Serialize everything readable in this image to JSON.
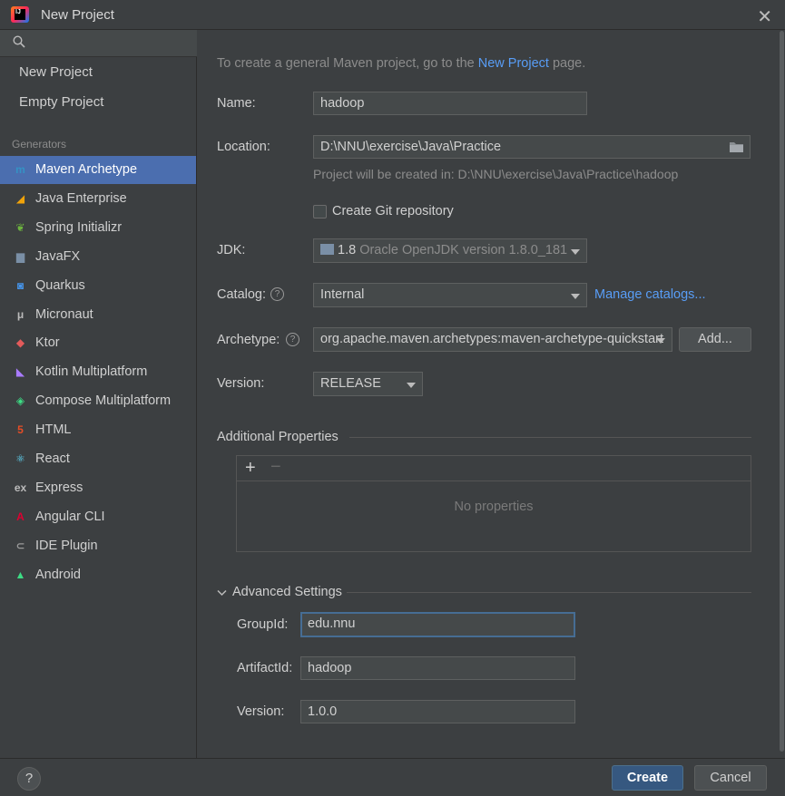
{
  "window": {
    "title": "New Project",
    "app_logo_text": "IJ"
  },
  "sidebar": {
    "search_placeholder": "",
    "links": [
      "New Project",
      "Empty Project"
    ],
    "generators_header": "Generators",
    "generators": [
      {
        "label": "Maven Archetype",
        "icon": "maven-icon",
        "glyph": "m",
        "color": "#3592c4"
      },
      {
        "label": "Java Enterprise",
        "icon": "java-enterprise-icon",
        "glyph": "◢",
        "color": "#f0a30a"
      },
      {
        "label": "Spring Initializr",
        "icon": "spring-icon",
        "glyph": "❦",
        "color": "#6db33f"
      },
      {
        "label": "JavaFX",
        "icon": "javafx-folder-icon",
        "glyph": "▆",
        "color": "#7a8fa6"
      },
      {
        "label": "Quarkus",
        "icon": "quarkus-icon",
        "glyph": "◙",
        "color": "#4695eb"
      },
      {
        "label": "Micronaut",
        "icon": "micronaut-icon",
        "glyph": "μ",
        "color": "#bbbbbb"
      },
      {
        "label": "Ktor",
        "icon": "ktor-icon",
        "glyph": "◆",
        "color": "#e35b5b"
      },
      {
        "label": "Kotlin Multiplatform",
        "icon": "kotlin-icon",
        "glyph": "◣",
        "color": "#a97bff"
      },
      {
        "label": "Compose Multiplatform",
        "icon": "compose-icon",
        "glyph": "◈",
        "color": "#3ddc84"
      },
      {
        "label": "HTML",
        "icon": "html5-icon",
        "glyph": "5",
        "color": "#e44d26"
      },
      {
        "label": "React",
        "icon": "react-icon",
        "glyph": "⚛",
        "color": "#61dafb"
      },
      {
        "label": "Express",
        "icon": "express-icon",
        "glyph": "ex",
        "color": "#bbbbbb"
      },
      {
        "label": "Angular CLI",
        "icon": "angular-icon",
        "glyph": "A",
        "color": "#dd0031"
      },
      {
        "label": "IDE Plugin",
        "icon": "plugin-icon",
        "glyph": "⊂",
        "color": "#9a9a9a"
      },
      {
        "label": "Android",
        "icon": "android-icon",
        "glyph": "▲",
        "color": "#3ddc84"
      }
    ],
    "selected_index": 0
  },
  "main": {
    "intro_prefix": "To create a general Maven project, go to the ",
    "intro_link": "New Project",
    "intro_suffix": " page.",
    "name_label": "Name:",
    "name_value": "hadoop",
    "location_label": "Location:",
    "location_value": "D:\\NNU\\exercise\\Java\\Practice",
    "location_hint": "Project will be created in: D:\\NNU\\exercise\\Java\\Practice\\hadoop",
    "git_label": "Create Git repository",
    "git_checked": false,
    "jdk_label": "JDK:",
    "jdk_version": "1.8",
    "jdk_desc": "Oracle OpenJDK version 1.8.0_181",
    "catalog_label": "Catalog:",
    "catalog_value": "Internal",
    "manage_catalogs": "Manage catalogs...",
    "archetype_label": "Archetype:",
    "archetype_value": "org.apache.maven.archetypes:maven-archetype-quickstart",
    "add_button": "Add...",
    "version_label": "Version:",
    "version_value": "RELEASE",
    "additional_props_header": "Additional Properties",
    "props_add": "+",
    "props_remove": "−",
    "no_properties": "No properties",
    "advanced_header": "Advanced Settings",
    "groupid_label": "GroupId:",
    "groupid_value": "edu.nnu",
    "artifactid_label": "ArtifactId:",
    "artifactid_value": "hadoop",
    "adv_version_label": "Version:",
    "adv_version_value": "1.0.0"
  },
  "footer": {
    "help": "?",
    "create": "Create",
    "cancel": "Cancel"
  }
}
